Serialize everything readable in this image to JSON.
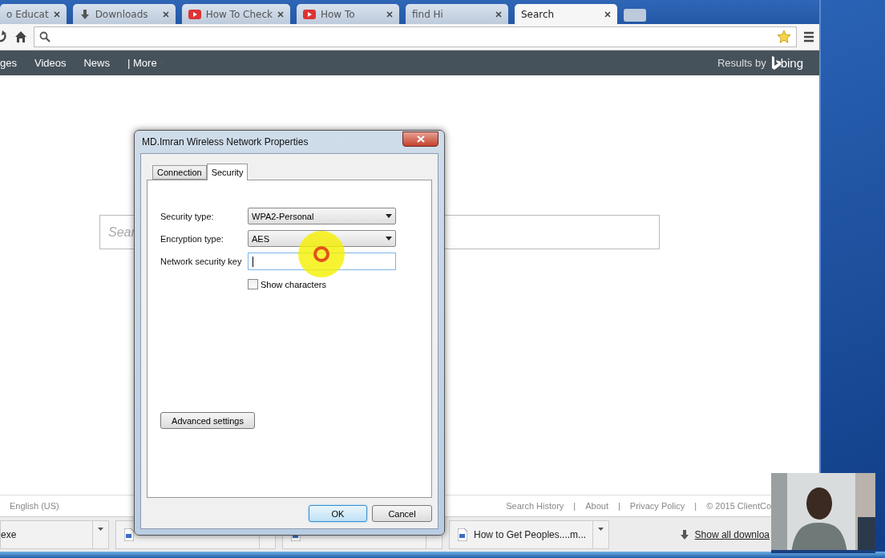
{
  "browser": {
    "tabs": [
      {
        "label": "o Educat",
        "kind": "plain",
        "selected": false
      },
      {
        "label": "Downloads",
        "kind": "download",
        "selected": false
      },
      {
        "label": "How To Check",
        "kind": "video",
        "selected": false
      },
      {
        "label": "How To",
        "kind": "video",
        "selected": false
      },
      {
        "label": "find Hi",
        "kind": "plain",
        "selected": false
      },
      {
        "label": "Search",
        "kind": "plain",
        "selected": true
      }
    ],
    "nav": {
      "links": [
        "ges",
        "Videos",
        "News",
        "| More"
      ],
      "attribution": "Results by",
      "brand": "bing"
    },
    "search": {
      "placeholder": "Sear"
    },
    "footer": {
      "language": "English (US)",
      "links": [
        "Search History",
        "|",
        "About",
        "|",
        "Privacy Policy",
        "|",
        "© 2015 ClientCo"
      ]
    },
    "downloads": {
      "items": [
        {
          "name": "exe",
          "kind": "plain"
        },
        {
          "kind": "file"
        },
        {
          "kind": "file"
        },
        {
          "name": "How to Get Peoples....m...",
          "kind": "file"
        }
      ],
      "show_all": "Show all downloa"
    }
  },
  "dialog": {
    "title": "MD.Imran Wireless Network Properties",
    "tabs": [
      {
        "label": "Connection",
        "selected": false
      },
      {
        "label": "Security",
        "selected": true
      }
    ],
    "fields": [
      {
        "label": "Security type:",
        "kind": "select",
        "value": "WPA2-Personal"
      },
      {
        "label": "Encryption type:",
        "kind": "select",
        "value": "AES"
      },
      {
        "label": "Network security key",
        "kind": "text",
        "focused": true
      }
    ],
    "checkbox": {
      "label": "Show characters",
      "checked": false
    },
    "advanced": "Advanced settings",
    "buttons": [
      {
        "label": "OK",
        "default": true
      },
      {
        "label": "Cancel",
        "default": false
      }
    ]
  }
}
